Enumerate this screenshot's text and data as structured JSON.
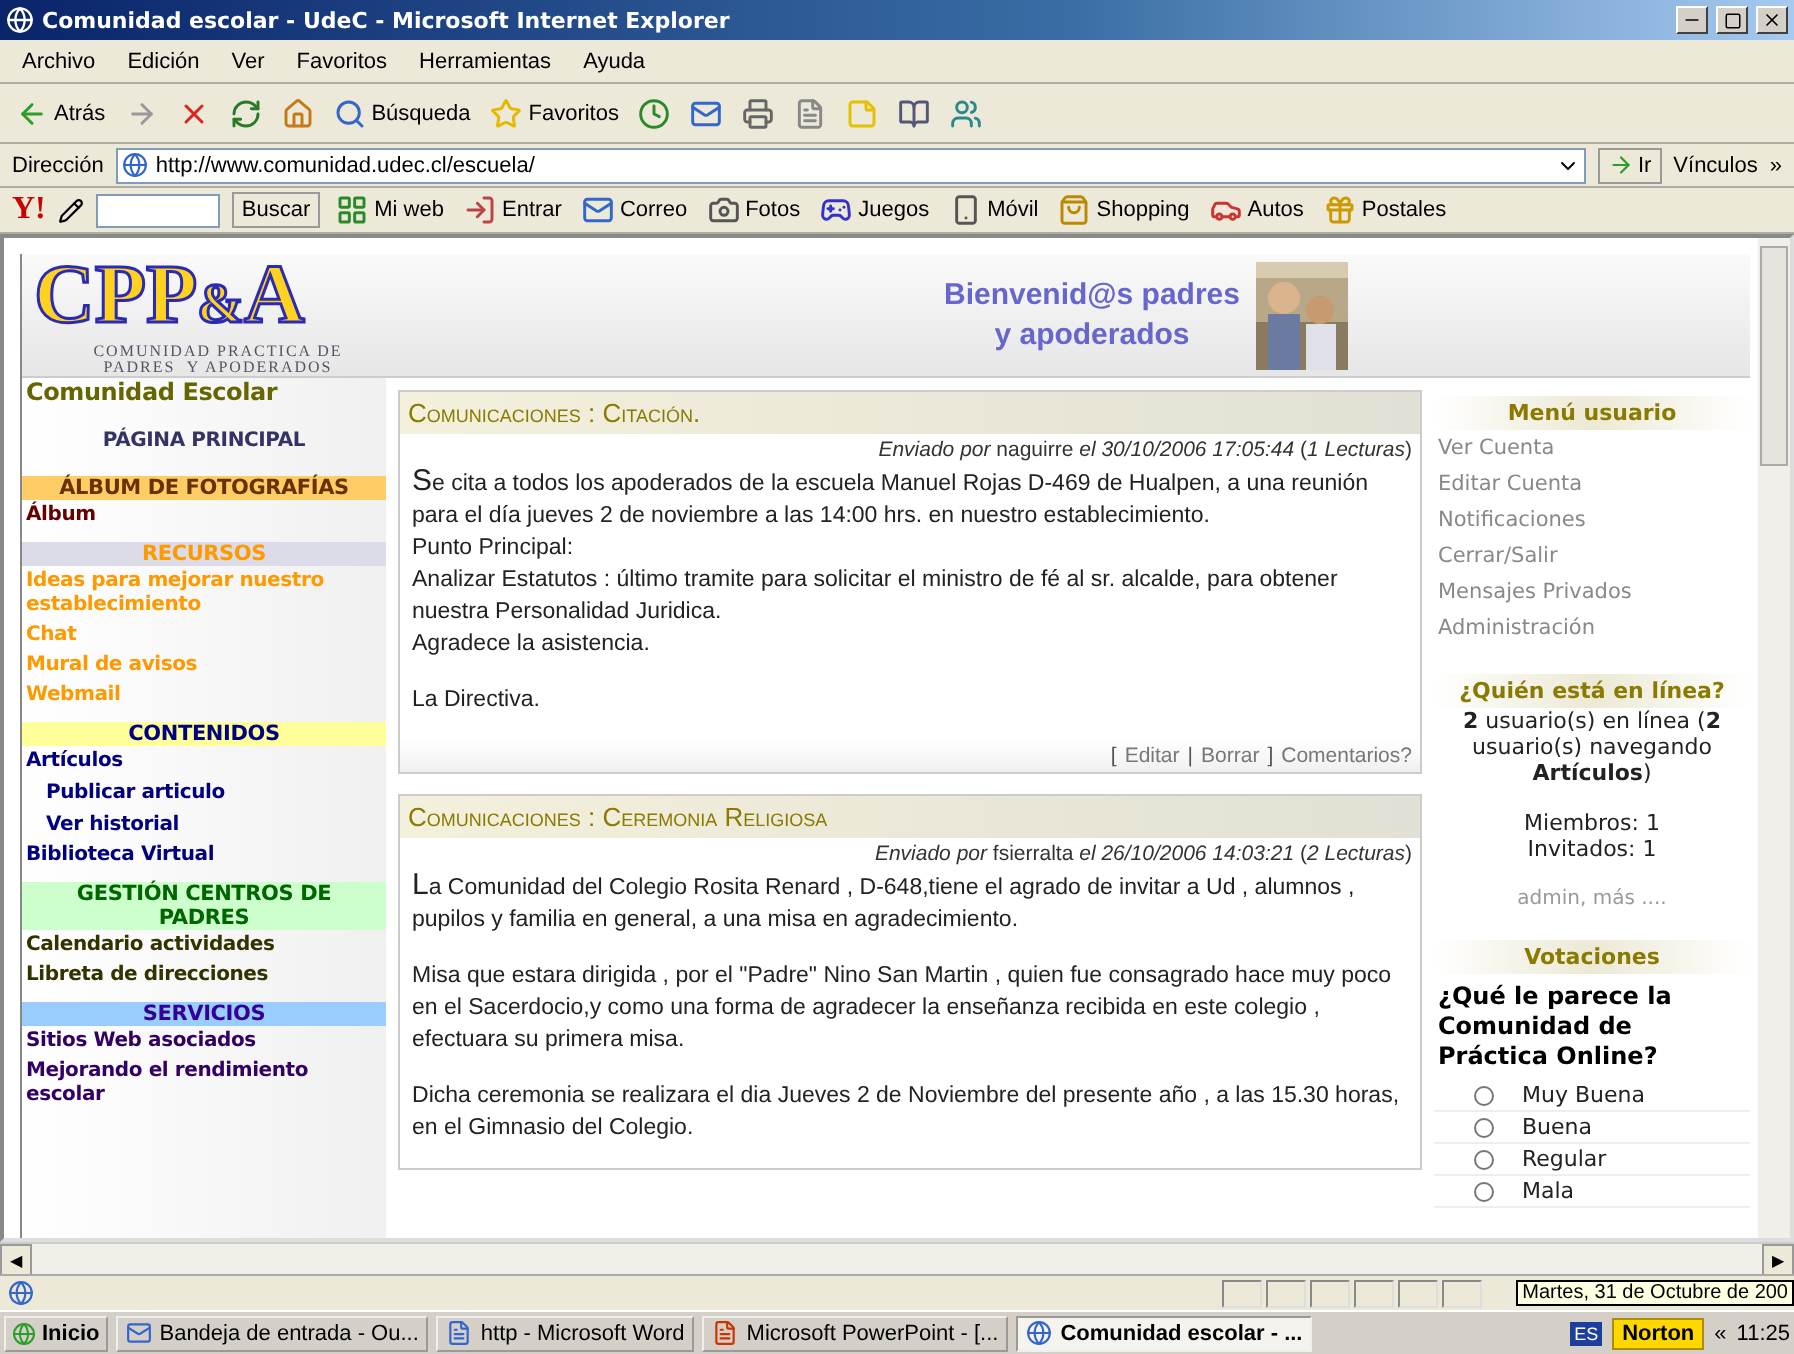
{
  "window": {
    "title": "Comunidad escolar - UdeC - Microsoft Internet Explorer"
  },
  "menu_bar": [
    "Archivo",
    "Edición",
    "Ver",
    "Favoritos",
    "Herramientas",
    "Ayuda"
  ],
  "toolbar": [
    {
      "kind": "back",
      "label": "Atrás"
    },
    {
      "kind": "forward"
    },
    {
      "kind": "stop"
    },
    {
      "kind": "refresh"
    },
    {
      "kind": "home"
    },
    {
      "kind": "search",
      "label": "Búsqueda"
    },
    {
      "kind": "favorites",
      "label": "Favoritos"
    },
    {
      "kind": "history"
    },
    {
      "kind": "mail"
    },
    {
      "kind": "print"
    },
    {
      "kind": "edit"
    },
    {
      "kind": "notes"
    },
    {
      "kind": "research"
    },
    {
      "kind": "messenger"
    }
  ],
  "address_bar": {
    "label": "Dirección",
    "url": "http://www.comunidad.udec.cl/escuela/",
    "go": "Ir",
    "links": "Vínculos",
    "chevron": "»"
  },
  "yahoo_bar": {
    "logo": "Y!",
    "search_button": "Buscar",
    "items": [
      {
        "kind": "myweb",
        "label": "Mi web"
      },
      {
        "kind": "login",
        "label": "Entrar"
      },
      {
        "kind": "mail",
        "label": "Correo"
      },
      {
        "kind": "photos",
        "label": "Fotos"
      },
      {
        "kind": "games",
        "label": "Juegos"
      },
      {
        "kind": "mobile",
        "label": "Móvil"
      },
      {
        "kind": "shopping",
        "label": "Shopping"
      },
      {
        "kind": "autos",
        "label": "Autos"
      },
      {
        "kind": "cards",
        "label": "Postales"
      }
    ]
  },
  "header": {
    "logo_main": "CPP",
    "logo_amp": "&",
    "logo_end": "A",
    "logo_subtitle": [
      "COMUNIDAD PRACTICA DE",
      "PADRES  Y APODERADOS"
    ],
    "welcome": [
      "Bienvenid@s padres",
      "y apoderados"
    ]
  },
  "sidebar": {
    "title": "Comunidad Escolar",
    "home": "PÁGINA PRINCIPAL",
    "sections": [
      {
        "kind": "album",
        "heading": "ÁLBUM DE FOTOGRAFÍAS",
        "color": "#ffcc66",
        "items": [
          {
            "label": "Álbum"
          }
        ]
      },
      {
        "kind": "resources",
        "heading": "RECURSOS",
        "color": "#dcdce8",
        "items": [
          {
            "label": "Ideas para mejorar nuestro establecimiento"
          },
          {
            "label": "Chat"
          },
          {
            "label": "Mural de avisos"
          },
          {
            "label": "Webmail"
          }
        ]
      },
      {
        "kind": "contents",
        "heading": "CONTENIDOS",
        "color": "#ffff99",
        "items": [
          {
            "label": "Artículos",
            "children": [
              {
                "label": "Publicar articulo"
              },
              {
                "label": "Ver historial"
              }
            ]
          },
          {
            "label": "Biblioteca Virtual"
          }
        ]
      },
      {
        "kind": "parents",
        "heading": "GESTIÓN CENTROS DE PADRES",
        "color": "#ccffcc",
        "items": [
          {
            "label": "Calendario actividades"
          },
          {
            "label": "Libreta de direcciones"
          }
        ]
      },
      {
        "kind": "services",
        "heading": "SERVICIOS",
        "color": "#99ccff",
        "items": [
          {
            "label": "Sitios Web asociados"
          },
          {
            "label": "Mejorando el rendimiento escolar"
          }
        ]
      }
    ]
  },
  "articles": [
    {
      "title": "Comunicaciones : Citación.",
      "meta": "*Enviado por* naguirre *el 30/10/2006 17:05:44* (*1 Lecturas*)",
      "paragraphs": [
        "Se cita a todos los apoderados de la escuela Manuel Rojas D-469 de Hualpen, a una reunión para el día jueves 2 de noviembre a las 14:00 hrs. en nuestro establecimiento.\nPunto Principal:\nAnalizar Estatutos : último tramite para solicitar el ministro de fé al sr. alcalde, para obtener nuestra Personalidad Juridica.\nAgradece la asistencia.",
        "La Directiva."
      ],
      "actions": [
        {
          "kind": "text",
          "label": "["
        },
        {
          "kind": "link",
          "label": "Editar"
        },
        {
          "kind": "text",
          "label": "|"
        },
        {
          "kind": "link",
          "label": "Borrar"
        },
        {
          "kind": "text",
          "label": "]"
        },
        {
          "kind": "link",
          "label": "Comentarios?"
        }
      ]
    },
    {
      "title": "Comunicaciones : Ceremonia Religiosa",
      "meta": "*Enviado por* fsierralta *el 26/10/2006 14:03:21* (*2 Lecturas*)",
      "paragraphs": [
        "La Comunidad del Colegio Rosita Renard , D-648,tiene el agrado de invitar a Ud , alumnos , pupilos y familia en general, a una misa en agradecimiento.",
        "Misa que estara dirigida , por el \"Padre\" Nino San Martin , quien fue consagrado hace muy poco en el Sacerdocio,y como una forma de agradecer la enseñanza recibida en este colegio , efectuara su primera misa.",
        "Dicha ceremonia se realizara el dia Jueves 2 de Noviembre del presente año , a las 15.30 horas, en el Gimnasio del Colegio."
      ]
    }
  ],
  "user_menu": {
    "title": "Menú usuario",
    "items": [
      "Ver Cuenta",
      "Editar Cuenta",
      "Notificaciones",
      "Cerrar/Salir",
      "Mensajes Privados",
      "Administración"
    ]
  },
  "online": {
    "title": "¿Quién está en línea?",
    "summary": "**2** usuario(s) en línea (**2** usuario(s) navegando **Artículos**)",
    "members": "Miembros: 1",
    "guests": "Invitados: 1",
    "names": "admin, más ...."
  },
  "poll": {
    "title": "Votaciones",
    "question": "¿Qué le parece la Comunidad de Práctica Online?",
    "options": [
      {
        "label": "Muy Buena",
        "selected": false
      },
      {
        "label": "Buena",
        "selected": false
      },
      {
        "label": "Regular",
        "selected": false
      },
      {
        "label": "Mala",
        "selected": false
      }
    ]
  },
  "scrollbar": {
    "left": "◀",
    "right": "▶"
  },
  "status_bar": {
    "tooltip": "Martes, 31 de Octubre de 200"
  },
  "taskbar": {
    "start": "Inicio",
    "tasks": [
      {
        "kind": "mail",
        "label": "Bandeja de entrada - Ou...",
        "selected": false
      },
      {
        "kind": "word",
        "label": "http - Microsoft Word",
        "selected": false
      },
      {
        "kind": "powerpoint",
        "label": "Microsoft PowerPoint - [...",
        "selected": false
      },
      {
        "kind": "browser",
        "label": "Comunidad escolar - ...",
        "selected": true
      }
    ],
    "language": "ES",
    "norton": "Norton",
    "chevron": "«",
    "clock": "11:25"
  }
}
